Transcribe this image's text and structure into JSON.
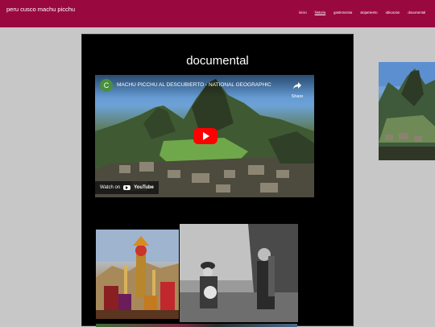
{
  "site": {
    "title": "peru cusco machu picchu"
  },
  "nav": {
    "items": [
      {
        "label": "inicio",
        "active": false
      },
      {
        "label": "historia",
        "active": true
      },
      {
        "label": "gastronomia",
        "active": false
      },
      {
        "label": "alojamiento",
        "active": false
      },
      {
        "label": "ubicacion",
        "active": false
      },
      {
        "label": "documental",
        "active": false
      }
    ]
  },
  "main": {
    "heading": "documental",
    "video": {
      "channel_initial": "C",
      "title": "MACHU PICCHU AL DESCUBIERTO - NATIONAL GEOGRAPHIC",
      "share_label": "Share",
      "watch_on_label": "Watch on",
      "youtube_label": "YouTube"
    }
  },
  "colors": {
    "header_bg": "#99093f",
    "page_bg": "#c7c7c7",
    "panel_bg": "#000000",
    "play_button": "#ff0000"
  },
  "icons": [
    "share-icon",
    "play-icon",
    "youtube-icon"
  ]
}
